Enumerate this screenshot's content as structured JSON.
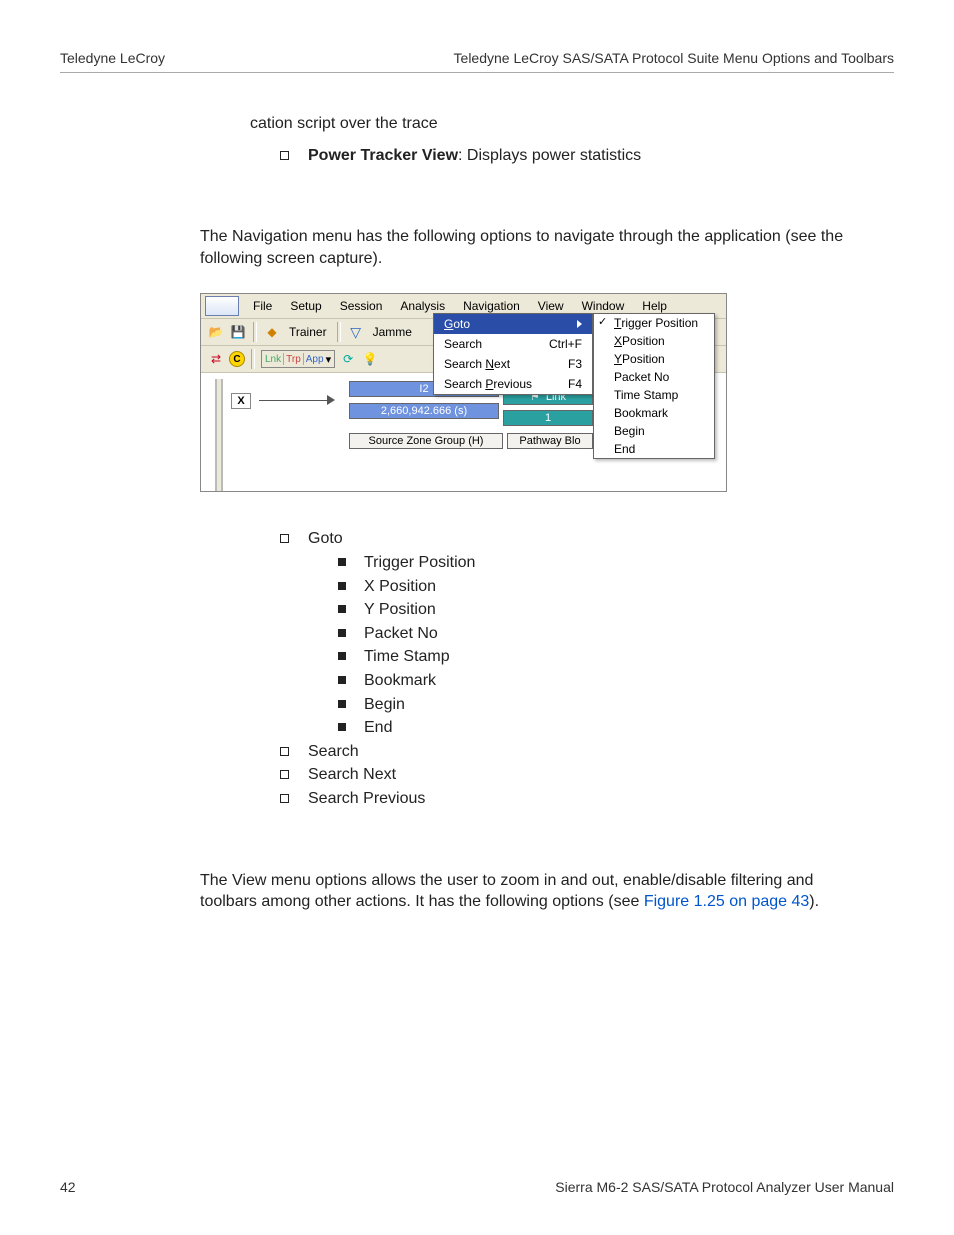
{
  "header": {
    "left": "Teledyne LeCroy",
    "right": "Teledyne LeCroy SAS/SATA Protocol Suite Menu Options and Toolbars"
  },
  "footer": {
    "page": "42",
    "title": "Sierra M6-2 SAS/SATA Protocol Analyzer User Manual"
  },
  "top_fragment": "cation script over the trace",
  "pt_label": "Power Tracker View",
  "pt_desc": ": Displays power statistics",
  "nav_para": "The Navigation menu has the following options to navigate through the application (see the following screen capture).",
  "menus": {
    "file": "File",
    "setup": "Setup",
    "session": "Session",
    "analysis": "Analysis",
    "navigation": "Navigation",
    "view": "View",
    "window": "Window",
    "help": "Help"
  },
  "toolbar": {
    "trainer": "Trainer",
    "jammer": "Jamme",
    "lnk": "Lnk",
    "trp": "Trp",
    "app": "App"
  },
  "nav_dropdown": {
    "goto": "Goto",
    "search": "Search",
    "search_sc": "Ctrl+F",
    "search_next": "Search Next",
    "search_next_sc": "F3",
    "search_prev": "Search Previous",
    "search_prev_sc": "F4"
  },
  "goto_submenu": {
    "trigger": "Trigger Position",
    "x": "X Position",
    "y": "Y Position",
    "packet": "Packet No",
    "timestamp": "Time Stamp",
    "bookmark": "Bookmark",
    "begin": "Begin",
    "end": "End"
  },
  "cells": {
    "i2": "I2",
    "time": "2,660,942.666 (s)",
    "link": "Link",
    "one": "1",
    "szg": "Source Zone Group (H)",
    "pb": "Pathway Blo"
  },
  "list": {
    "goto": "Goto",
    "goto_items": {
      "trigger": "Trigger Position",
      "x": "X Position",
      "y": "Y Position",
      "packet": "Packet No",
      "timestamp": "Time Stamp",
      "bookmark": "Bookmark",
      "begin": "Begin",
      "end": "End"
    },
    "search": "Search",
    "search_next": "Search Next",
    "search_prev": "Search Previous"
  },
  "view_para_a": "The View menu options allows the user to zoom in and out, enable/disable filtering and toolbars among other actions. It has the following options (see ",
  "view_link": "Figure 1.25 on page 43",
  "view_para_b": ")."
}
